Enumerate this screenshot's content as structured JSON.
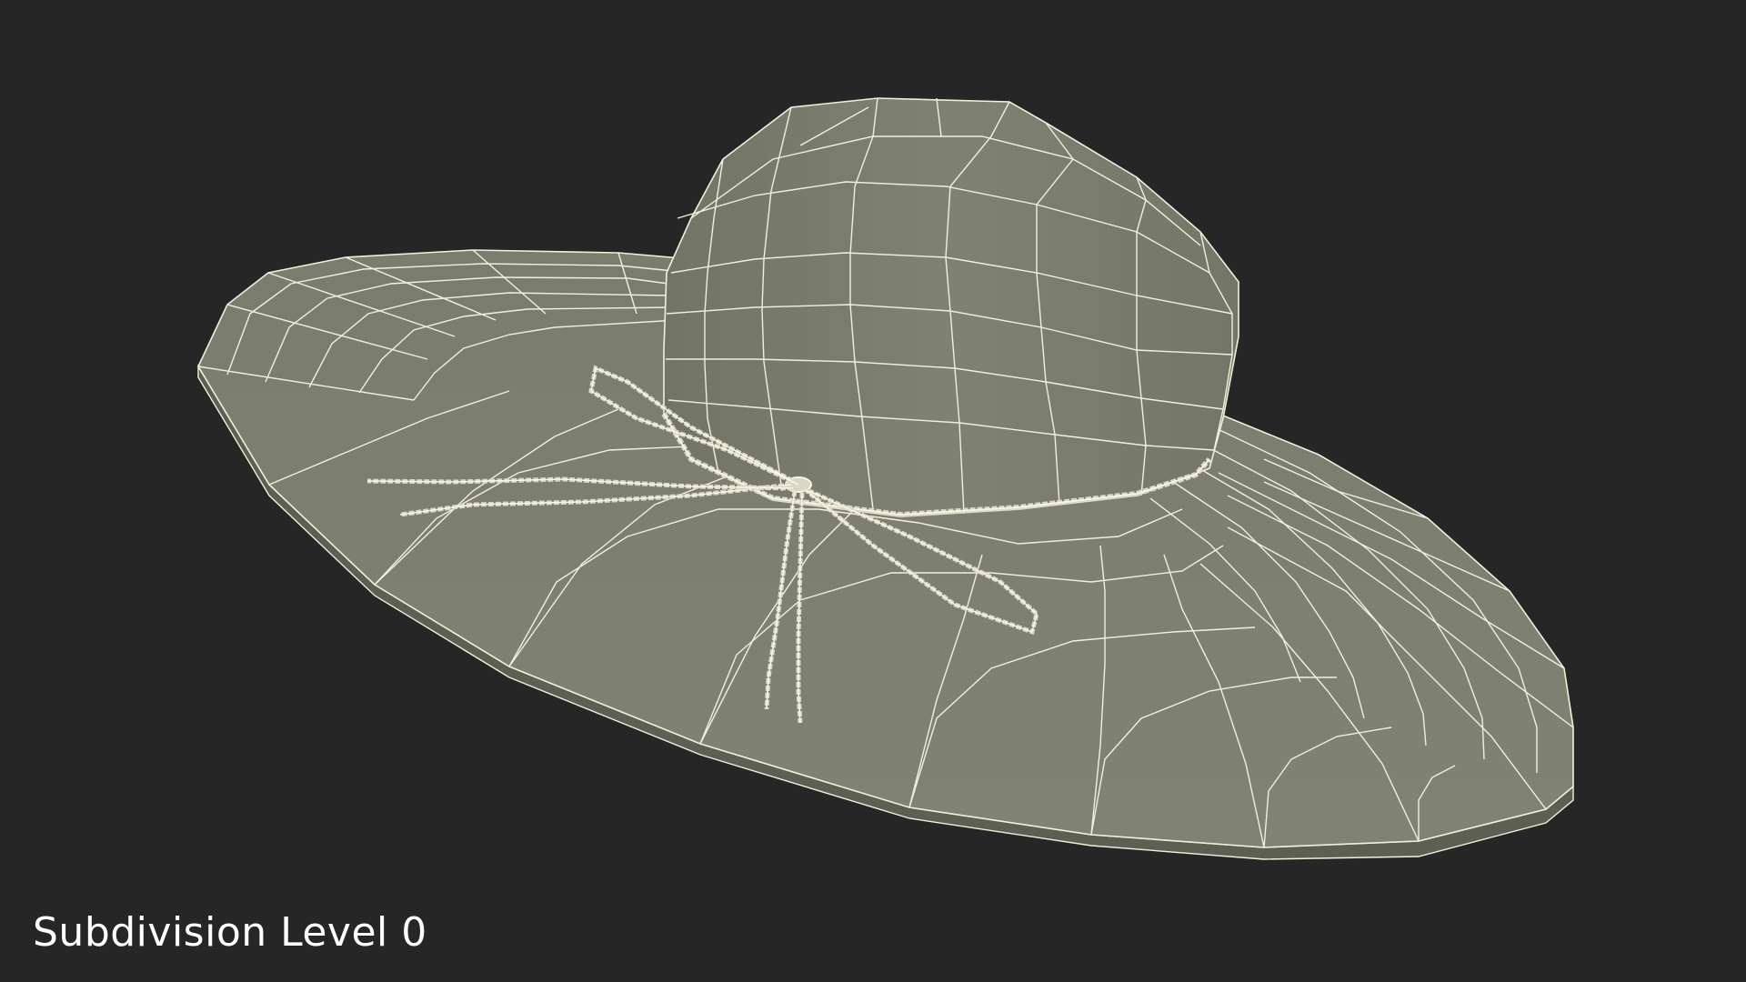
{
  "caption": "Subdivision Level 0",
  "colors": {
    "background": "#262626",
    "surface": "#7c7e70",
    "surface_shadow": "#6a6c5f",
    "surface_light": "#8a8c7e",
    "wire": "#f2f0dc",
    "caption": "#ffffff"
  }
}
